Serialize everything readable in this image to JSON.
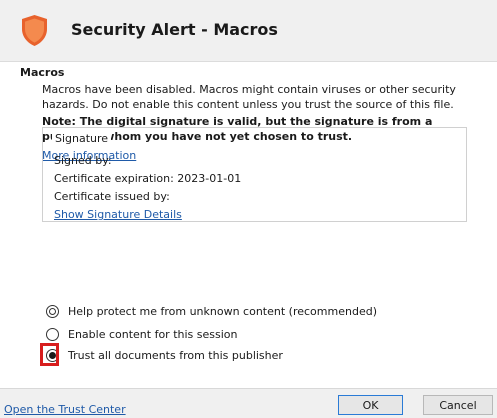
{
  "window": {
    "title": "Security Alert - Macros"
  },
  "section": {
    "heading": "Macros",
    "description": "Macros have been disabled. Macros might contain viruses or other security hazards. Do not enable this content unless you trust the source of this file.",
    "note": "Note: The digital signature is valid, but the signature is from a publisher whom you have not yet chosen to trust.",
    "more_info_link": "More information"
  },
  "signature": {
    "legend": "Signature",
    "signed_by": "Signed by:",
    "certificate_expiration": "Certificate expiration: 2023-01-01",
    "certificate_issued_by": "Certificate issued by:",
    "show_details_link": "Show Signature Details"
  },
  "options": [
    {
      "label": "Help protect me from unknown content (recommended)",
      "selected": false
    },
    {
      "label": "Enable content for this session",
      "selected": false
    },
    {
      "label": "Trust all documents from this publisher",
      "selected": true
    }
  ],
  "footer": {
    "trust_center_link": "Open the Trust Center",
    "ok_label": "OK",
    "cancel_label": "Cancel"
  },
  "colors": {
    "shield": "#e8622c",
    "link": "#1f5aa8",
    "highlight": "#d71d1d"
  },
  "icons": {
    "title": "shield-warning-icon"
  }
}
